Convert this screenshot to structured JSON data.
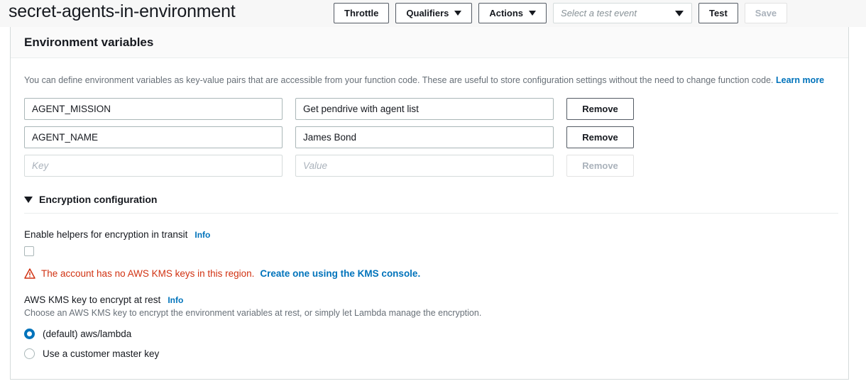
{
  "header": {
    "function_name": "secret-agents-in-environment",
    "throttle_label": "Throttle",
    "qualifiers_label": "Qualifiers",
    "actions_label": "Actions",
    "test_event_placeholder": "Select a test event",
    "test_label": "Test",
    "save_label": "Save"
  },
  "panel": {
    "title": "Environment variables",
    "description": "You can define environment variables as key-value pairs that are accessible from your function code. These are useful to store configuration settings without the need to change function code.",
    "learn_more": "Learn more"
  },
  "env_vars": {
    "key_placeholder": "Key",
    "value_placeholder": "Value",
    "remove_label": "Remove",
    "rows": [
      {
        "key": "AGENT_MISSION",
        "value": "Get pendrive with agent list",
        "empty": false
      },
      {
        "key": "AGENT_NAME",
        "value": "James Bond",
        "empty": false
      },
      {
        "key": "",
        "value": "",
        "empty": true
      }
    ]
  },
  "encryption": {
    "section_title": "Encryption configuration",
    "transit_label": "Enable helpers for encryption in transit",
    "transit_info": "Info",
    "transit_checked": false,
    "warning_text": "The account has no AWS KMS keys in this region.",
    "warning_link": "Create one using the KMS console.",
    "rest_label": "AWS KMS key to encrypt at rest",
    "rest_info": "Info",
    "rest_hint": "Choose an AWS KMS key to encrypt the environment variables at rest, or simply let Lambda manage the encryption.",
    "options": [
      {
        "label": "(default) aws/lambda",
        "selected": true
      },
      {
        "label": "Use a customer master key",
        "selected": false
      }
    ]
  },
  "colors": {
    "link_blue": "#0073bb",
    "warning_red": "#d13212",
    "text_dark": "#16191f",
    "text_muted": "#687078"
  }
}
